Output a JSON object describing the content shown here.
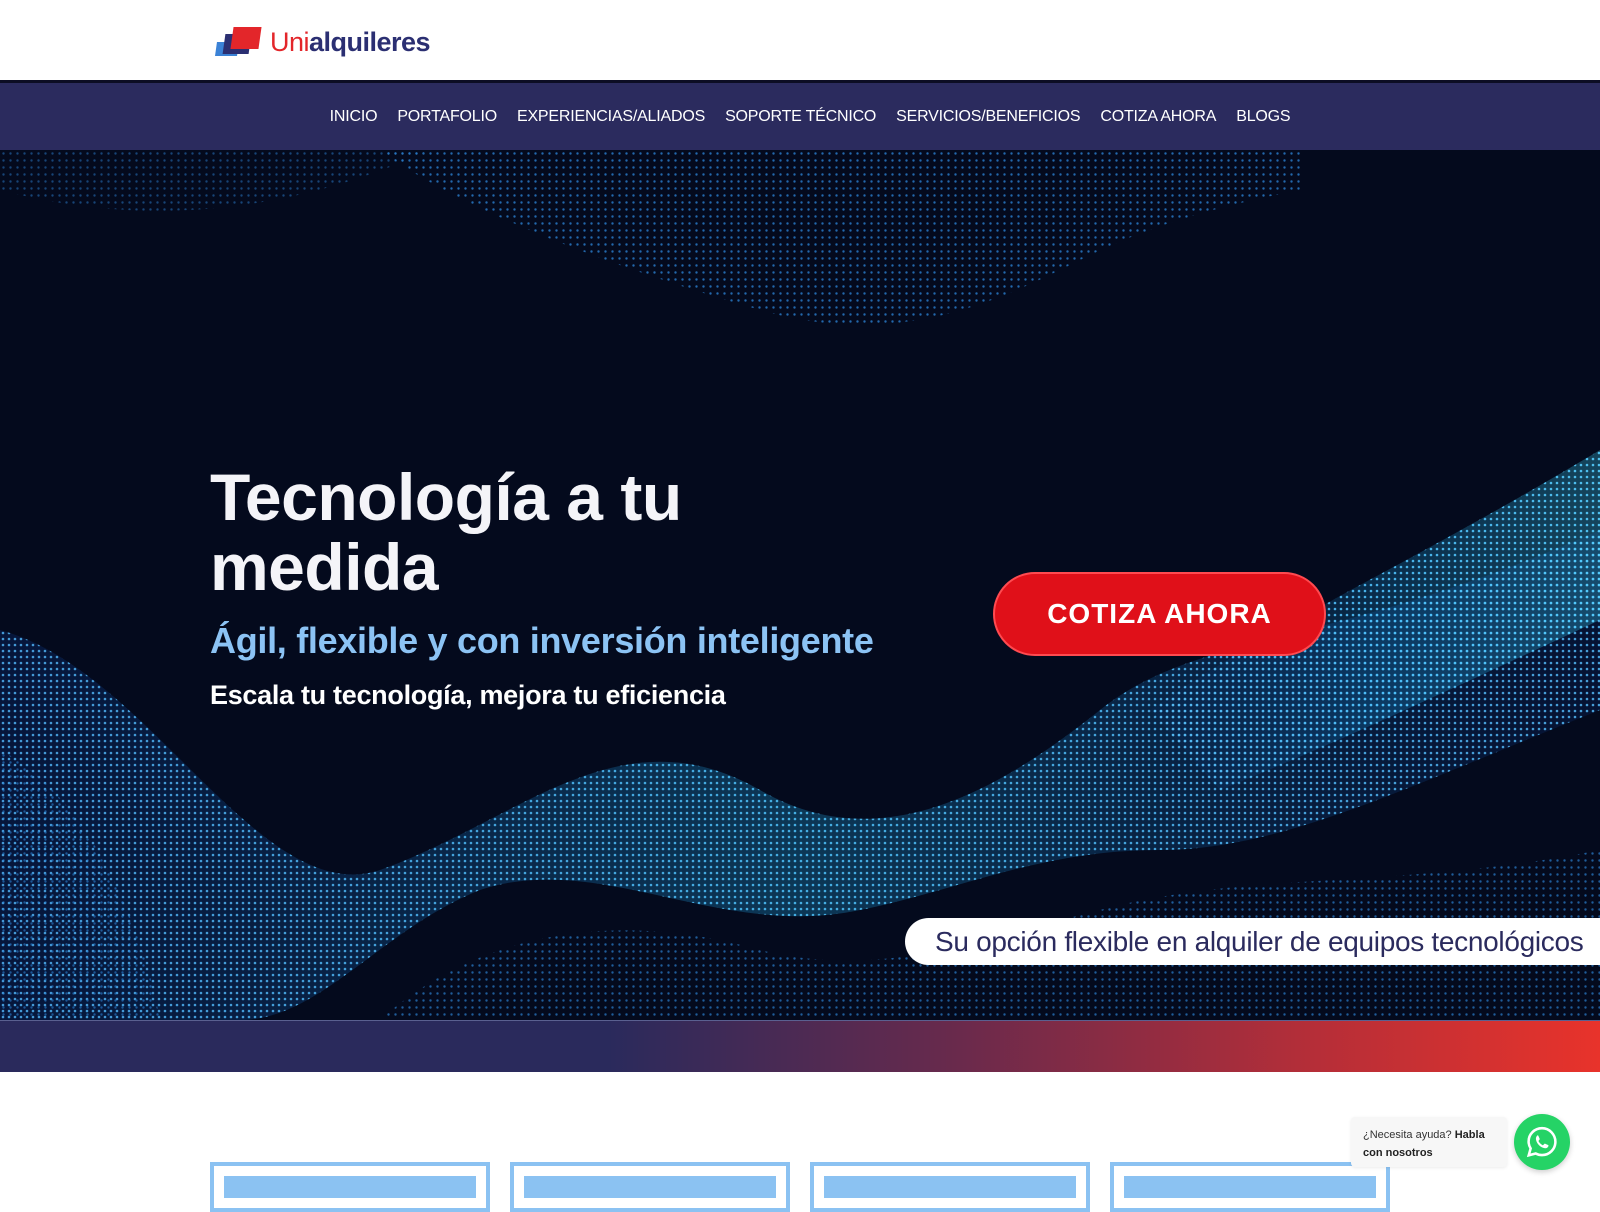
{
  "header": {
    "logo": {
      "part1": "Uni",
      "part2": "alquileres"
    }
  },
  "nav": {
    "items": [
      {
        "label": "INICIO"
      },
      {
        "label": "PORTAFOLIO"
      },
      {
        "label": "EXPERIENCIAS/ALIADOS"
      },
      {
        "label": "SOPORTE TÉCNICO"
      },
      {
        "label": "SERVICIOS/BENEFICIOS"
      },
      {
        "label": "COTIZA AHORA"
      },
      {
        "label": "BLOGS"
      }
    ]
  },
  "hero": {
    "title": "Tecnología a tu medida",
    "subtitle": "Ágil, flexible y con inversión inteligente",
    "subtitle2": "Escala tu tecnología, mejora tu eficiencia",
    "cta_label": "COTIZA AHORA",
    "tagline": "Su opción flexible en alquiler de equipos tecnológicos"
  },
  "help": {
    "prefix": "¿Necesita ayuda?",
    "bold": "Habla con nosotros"
  },
  "icons": {
    "whatsapp": "whatsapp-icon"
  },
  "colors": {
    "brand_red": "#e3262a",
    "brand_navy": "#2b2b5e",
    "accent_blue": "#8cc3f4",
    "whatsapp_green": "#25d366"
  }
}
